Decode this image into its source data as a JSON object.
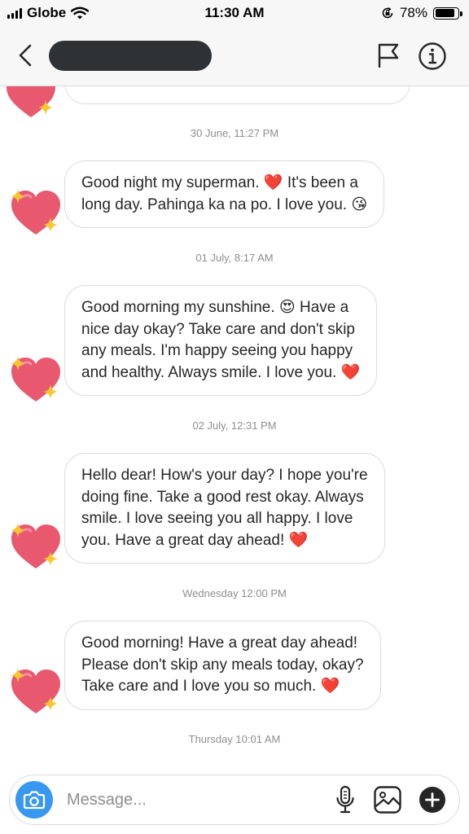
{
  "status_bar": {
    "carrier": "Globe",
    "time": "11:30 AM",
    "battery": "78%",
    "battery_level": 0.78,
    "icons": [
      "signal-icon",
      "wifi-icon",
      "orientation-lock-icon",
      "battery-icon"
    ]
  },
  "header": {
    "contact_name": "",
    "contact_name_redacted": true,
    "icons": [
      "back-chevron-icon",
      "flag-icon",
      "info-icon"
    ]
  },
  "messages": [
    {
      "timestamp": "30 June, 11:27 PM",
      "lines": [
        "Good night my superman. ❤️ It's been a",
        "long day. Pahinga ka na po. I love you. 😘"
      ]
    },
    {
      "timestamp": "01 July, 8:17 AM",
      "lines": [
        "Good morning my sunshine. 😍 Have a",
        "nice day okay? Take care and don't skip",
        "any meals. I'm happy seeing you happy",
        "and healthy. Always smile. I love you. ❤️"
      ]
    },
    {
      "timestamp": "02 July, 12:31 PM",
      "lines": [
        "Hello dear! How's your day? I hope you're",
        "doing fine. Take a good rest okay. Always",
        "smile. I love seeing you all happy. I love",
        "you. Have a great day ahead! ❤️"
      ]
    },
    {
      "timestamp": "Wednesday 12:00 PM",
      "lines": [
        "Good morning! Have a great day ahead!",
        "Please don't skip any meals today, okay?",
        "Take care and I love you so much. ❤️"
      ]
    }
  ],
  "last_timestamp": "Thursday 10:01 AM",
  "composer": {
    "placeholder": "Message...",
    "icons": [
      "camera-icon",
      "microphone-icon",
      "gallery-icon",
      "plus-icon"
    ]
  },
  "colors": {
    "accent_blue": "#3897f0",
    "heart_pink": "#e8586f",
    "sparkle_yellow": "#f8c630",
    "bubble_border": "#dbdbdb",
    "timestamp_gray": "#8e8e8e"
  }
}
